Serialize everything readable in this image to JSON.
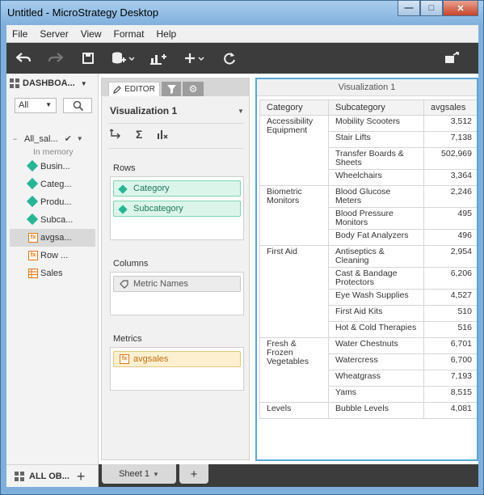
{
  "window": {
    "title": "Untitled - MicroStrategy Desktop"
  },
  "window_buttons": {
    "minimize": "—",
    "maximize": "□",
    "close": "✕"
  },
  "menu": [
    "File",
    "Server",
    "View",
    "Format",
    "Help"
  ],
  "toolbar": {
    "icons": [
      "undo-icon",
      "redo-icon",
      "save-icon",
      "add-data-icon",
      "insert-visualization-icon",
      "add-icon",
      "refresh-icon",
      "present-icon"
    ]
  },
  "datasets": {
    "header": "DASHBOA...",
    "filter_value": "All",
    "dataset_name": "All_sal...",
    "dataset_status": "In memory",
    "objects": [
      {
        "label": "Busin...",
        "kind": "attribute"
      },
      {
        "label": "Categ...",
        "kind": "attribute"
      },
      {
        "label": "Produ...",
        "kind": "attribute"
      },
      {
        "label": "Subca...",
        "kind": "attribute"
      },
      {
        "label": "avgsa...",
        "kind": "metric",
        "selected": true
      },
      {
        "label": "Row ...",
        "kind": "metric"
      },
      {
        "label": "Sales",
        "kind": "metric-table"
      }
    ],
    "footer_label": "ALL OB..."
  },
  "editor": {
    "tab_editor": "EDITOR",
    "viz_name": "Visualization 1",
    "rows_label": "Rows",
    "rows": [
      "Category",
      "Subcategory"
    ],
    "columns_label": "Columns",
    "columns": [
      "Metric Names"
    ],
    "metrics_label": "Metrics",
    "metrics": [
      "avgsales"
    ]
  },
  "visualization": {
    "title": "Visualization 1",
    "headers": [
      "Category",
      "Subcategory",
      "avgsales"
    ],
    "groups": [
      {
        "category": "Accessibility Equipment",
        "rows": [
          {
            "sub": "Mobility Scooters",
            "val": "3,512"
          },
          {
            "sub": "Stair Lifts",
            "val": "7,138"
          },
          {
            "sub": "Transfer Boards & Sheets",
            "val": "502,969"
          },
          {
            "sub": "Wheelchairs",
            "val": "3,364"
          }
        ]
      },
      {
        "category": "Biometric Monitors",
        "rows": [
          {
            "sub": "Blood Glucose Meters",
            "val": "2,246"
          },
          {
            "sub": "Blood Pressure Monitors",
            "val": "495"
          },
          {
            "sub": "Body Fat Analyzers",
            "val": "496"
          }
        ]
      },
      {
        "category": "First Aid",
        "rows": [
          {
            "sub": "Antiseptics & Cleaning",
            "val": "2,954"
          },
          {
            "sub": "Cast & Bandage Protectors",
            "val": "6,206"
          },
          {
            "sub": "Eye Wash Supplies",
            "val": "4,527"
          },
          {
            "sub": "First Aid Kits",
            "val": "510"
          },
          {
            "sub": "Hot & Cold Therapies",
            "val": "516"
          }
        ]
      },
      {
        "category": "Fresh & Frozen Vegetables",
        "rows": [
          {
            "sub": "Water Chestnuts",
            "val": "6,701"
          },
          {
            "sub": "Watercress",
            "val": "6,700"
          },
          {
            "sub": "Wheatgrass",
            "val": "7,193"
          },
          {
            "sub": "Yams",
            "val": "8,515"
          }
        ]
      },
      {
        "category": "Levels",
        "rows": [
          {
            "sub": "Bubble Levels",
            "val": "4,081"
          }
        ]
      }
    ]
  },
  "sheets": {
    "active": "Sheet 1",
    "add": "+"
  }
}
